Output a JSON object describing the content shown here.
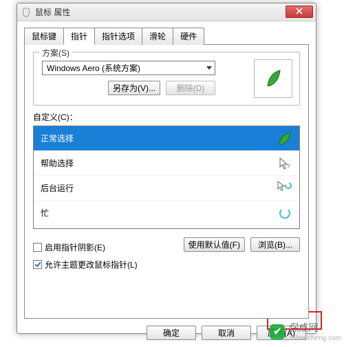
{
  "window": {
    "title": "鼠标 属性"
  },
  "tabs": {
    "items": [
      {
        "label": "鼠标键"
      },
      {
        "label": "指针"
      },
      {
        "label": "指针选项"
      },
      {
        "label": "滑轮"
      },
      {
        "label": "硬件"
      }
    ],
    "active_index": 1
  },
  "scheme": {
    "legend": "方案(S)",
    "selected": "Windows Aero (系统方案)",
    "saveas_label": "另存为(V)...",
    "delete_label": "删除(D)"
  },
  "custom": {
    "legend": "自定义(C)：",
    "items": [
      {
        "label": "正常选择",
        "icon": "leaf-cursor",
        "selected": true
      },
      {
        "label": "帮助选择",
        "icon": "help-cursor",
        "selected": false
      },
      {
        "label": "后台运行",
        "icon": "bg-cursor",
        "selected": false
      },
      {
        "label": "忙",
        "icon": "busy-cursor",
        "selected": false
      }
    ]
  },
  "options": {
    "shadow_label": "启用指针阴影(E)",
    "shadow_checked": false,
    "theme_label": "允许主题更改鼠标指针(L)",
    "theme_checked": true,
    "defaults_label": "使用默认值(F)",
    "browse_label": "浏览(B)..."
  },
  "buttons": {
    "ok": "确定",
    "cancel": "取消",
    "apply": "应用(A)"
  },
  "watermark": {
    "brand": "保成网",
    "url": "zsbaocheng.com"
  }
}
